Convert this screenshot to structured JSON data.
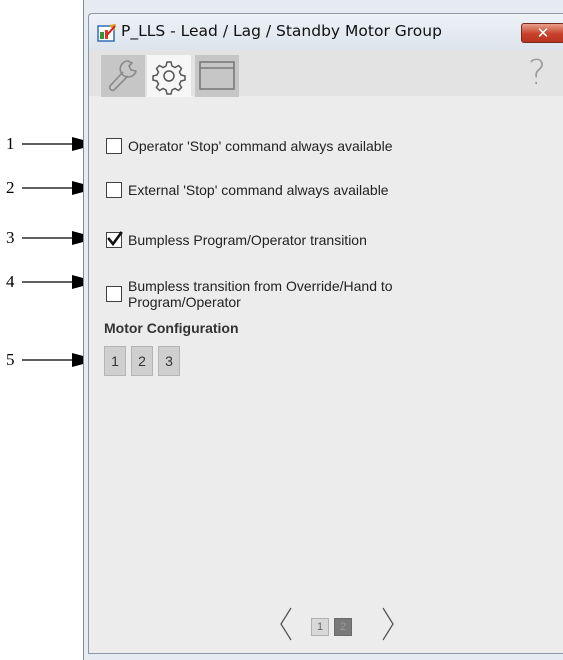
{
  "callouts": [
    "1",
    "2",
    "3",
    "4",
    "5"
  ],
  "window": {
    "title": "P_LLS - Lead / Lag / Standby Motor Group",
    "close_label": "✕"
  },
  "toolbar": {
    "tabs": [
      {
        "icon": "wrench-icon",
        "active": false
      },
      {
        "icon": "gear-icon",
        "active": true
      },
      {
        "icon": "window-icon",
        "active": false
      }
    ],
    "help_label": "?"
  },
  "options": [
    {
      "label": "Operator 'Stop' command always available",
      "checked": false
    },
    {
      "label": "External 'Stop' command always available",
      "checked": false
    },
    {
      "label": "Bumpless Program/Operator transition",
      "checked": true
    },
    {
      "label": "Bumpless transition from Override/Hand to Program/Operator",
      "checked": false
    }
  ],
  "motor_configuration": {
    "label": "Motor Configuration",
    "buttons": [
      "1",
      "2",
      "3"
    ]
  },
  "pager": {
    "pages": [
      "1",
      "2"
    ],
    "current": "2"
  },
  "colors": {
    "close_button": "#c7412a",
    "active_tab": "#f6f6f6",
    "inactive_tab": "#c6c6c6",
    "current_page": "#7a7a7a"
  }
}
